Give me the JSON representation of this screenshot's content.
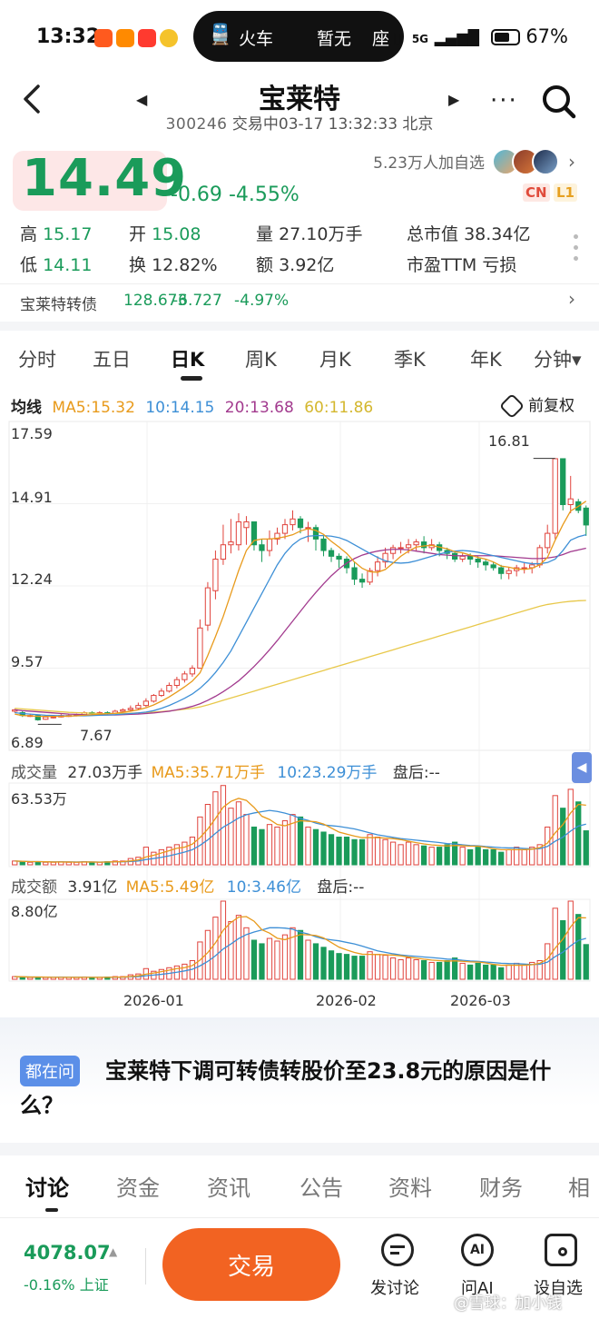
{
  "status_bar": {
    "time": "13:32",
    "island_icon": "train-icon",
    "island_label": "火车",
    "island_status": "暂无",
    "island_seat": "座",
    "network": "5G",
    "battery": "67%"
  },
  "header": {
    "stock_name": "宝莱特",
    "code": "300246",
    "trade_status": "交易中03-17 13:32:33 北京"
  },
  "quote": {
    "price": "14.49",
    "change": "-0.69",
    "change_pct": "-4.55%",
    "followers": "5.23万人加自选",
    "badge_cn": "CN",
    "badge_l1": "L1",
    "high_label": "高",
    "high": "15.17",
    "open_label": "开",
    "open": "15.08",
    "vol_label": "量",
    "vol": "27.10万手",
    "mcap_label": "总市值",
    "mcap": "38.34亿",
    "low_label": "低",
    "low": "14.11",
    "turn_label": "换",
    "turn": "12.82%",
    "amt_label": "额",
    "amt": "3.92亿",
    "pe_label": "市盈TTM",
    "pe": "亏损"
  },
  "bond": {
    "name": "宝莱特转债",
    "price": "128.673",
    "change": "-6.727",
    "change_pct": "-4.97%"
  },
  "kline_tabs": [
    "分时",
    "五日",
    "日K",
    "周K",
    "月K",
    "季K",
    "年K",
    "分钟▾"
  ],
  "ma_line": {
    "label": "均线",
    "ma5": "MA5:15.32",
    "ma10": "10:14.15",
    "ma20": "20:13.68",
    "ma60": "60:11.86",
    "adjust": "前复权"
  },
  "colors": {
    "up": "#e0433c",
    "down": "#1a9b5a",
    "ma5": "#e89a1b",
    "ma10": "#3d8fd6",
    "ma20": "#a23a8e",
    "ma60": "#e8c84a"
  },
  "price_axis": [
    "17.59",
    "14.91",
    "12.24",
    "9.57",
    "6.89"
  ],
  "high_marker": "16.81",
  "low_marker": "7.67",
  "volume": {
    "label": "成交量",
    "value": "27.03万手",
    "ma5": "MA5:35.71万手",
    "ma10": "10:23.29万手",
    "after": "盘后:--",
    "axis_max": "63.53万"
  },
  "amount": {
    "label": "成交额",
    "value": "3.91亿",
    "ma5": "MA5:5.49亿",
    "ma10": "10:3.46亿",
    "after": "盘后:--",
    "axis_max": "8.80亿"
  },
  "date_axis": [
    "2026-01",
    "2026-02",
    "2026-03"
  ],
  "chart_data": {
    "type": "candlestick",
    "ylim": [
      6.89,
      17.59
    ],
    "candles": [
      [
        8.0,
        8.05,
        7.95,
        8.08
      ],
      [
        7.95,
        7.85,
        7.8,
        8.0
      ],
      [
        7.85,
        7.85,
        7.8,
        7.92
      ],
      [
        7.85,
        7.7,
        7.67,
        7.88
      ],
      [
        7.72,
        7.8,
        7.7,
        7.84
      ],
      [
        7.8,
        7.8,
        7.75,
        7.86
      ],
      [
        7.8,
        7.85,
        7.78,
        7.9
      ],
      [
        7.85,
        7.85,
        7.8,
        7.9
      ],
      [
        7.85,
        7.88,
        7.82,
        7.92
      ],
      [
        7.88,
        7.95,
        7.85,
        8.0
      ],
      [
        7.95,
        7.92,
        7.88,
        8.0
      ],
      [
        7.92,
        7.95,
        7.88,
        8.0
      ],
      [
        7.95,
        7.92,
        7.88,
        8.0
      ],
      [
        7.92,
        8.0,
        7.9,
        8.05
      ],
      [
        8.0,
        8.05,
        7.95,
        8.1
      ],
      [
        8.05,
        8.1,
        8.0,
        8.2
      ],
      [
        8.1,
        8.2,
        8.05,
        8.3
      ],
      [
        8.2,
        8.35,
        8.15,
        8.45
      ],
      [
        8.35,
        8.55,
        8.3,
        8.6
      ],
      [
        8.55,
        8.7,
        8.5,
        8.8
      ],
      [
        8.7,
        8.9,
        8.65,
        9.0
      ],
      [
        8.9,
        9.1,
        8.8,
        9.2
      ],
      [
        9.1,
        9.3,
        9.0,
        9.4
      ],
      [
        9.3,
        9.5,
        9.2,
        9.6
      ],
      [
        9.5,
        10.9,
        9.5,
        11.2
      ],
      [
        11.0,
        12.3,
        10.8,
        12.5
      ],
      [
        12.2,
        13.3,
        11.9,
        13.6
      ],
      [
        13.3,
        13.8,
        13.1,
        14.5
      ],
      [
        13.8,
        13.9,
        13.5,
        14.7
      ],
      [
        13.8,
        14.6,
        13.6,
        14.9
      ],
      [
        14.4,
        14.6,
        13.8,
        14.8
      ],
      [
        14.6,
        13.8,
        13.6,
        14.6
      ],
      [
        13.8,
        13.6,
        13.2,
        14.0
      ],
      [
        13.6,
        14.0,
        13.4,
        14.3
      ],
      [
        14.0,
        14.2,
        13.8,
        14.4
      ],
      [
        14.2,
        14.5,
        14.0,
        14.7
      ],
      [
        14.5,
        14.7,
        14.3,
        15.0
      ],
      [
        14.7,
        14.4,
        14.2,
        14.8
      ],
      [
        14.4,
        14.4,
        13.9,
        14.6
      ],
      [
        14.4,
        14.0,
        13.6,
        14.5
      ],
      [
        14.0,
        13.6,
        13.4,
        14.1
      ],
      [
        13.6,
        13.4,
        13.2,
        13.7
      ],
      [
        13.4,
        13.3,
        13.0,
        13.5
      ],
      [
        13.3,
        13.0,
        12.8,
        13.4
      ],
      [
        13.0,
        12.6,
        12.4,
        13.2
      ],
      [
        12.6,
        12.5,
        12.3,
        12.8
      ],
      [
        12.5,
        12.9,
        12.4,
        13.0
      ],
      [
        12.9,
        13.2,
        12.7,
        13.4
      ],
      [
        13.2,
        13.5,
        13.0,
        13.7
      ],
      [
        13.5,
        13.7,
        13.3,
        13.8
      ],
      [
        13.7,
        13.7,
        13.5,
        13.9
      ],
      [
        13.7,
        13.8,
        13.5,
        14.0
      ],
      [
        13.8,
        13.9,
        13.6,
        14.0
      ],
      [
        13.9,
        13.7,
        13.5,
        14.1
      ],
      [
        13.7,
        13.8,
        13.6,
        14.0
      ],
      [
        13.8,
        13.6,
        13.4,
        13.9
      ],
      [
        13.6,
        13.5,
        13.3,
        13.7
      ],
      [
        13.5,
        13.3,
        13.2,
        13.6
      ],
      [
        13.3,
        13.4,
        13.2,
        13.5
      ],
      [
        13.4,
        13.3,
        13.1,
        13.5
      ],
      [
        13.3,
        13.2,
        13.0,
        13.4
      ],
      [
        13.2,
        13.1,
        12.9,
        13.3
      ],
      [
        13.1,
        13.0,
        12.9,
        13.2
      ],
      [
        13.0,
        12.8,
        12.6,
        13.1
      ],
      [
        12.8,
        12.9,
        12.6,
        13.0
      ],
      [
        12.9,
        13.0,
        12.7,
        13.1
      ],
      [
        13.0,
        13.0,
        12.8,
        13.2
      ],
      [
        13.0,
        13.1,
        12.8,
        13.2
      ],
      [
        13.1,
        13.7,
        13.0,
        13.8
      ],
      [
        13.7,
        14.2,
        13.5,
        14.5
      ],
      [
        14.2,
        16.8,
        14.0,
        16.81
      ],
      [
        16.8,
        15.2,
        15.0,
        16.7
      ],
      [
        15.2,
        15.4,
        14.9,
        16.2
      ],
      [
        15.3,
        15.0,
        14.9,
        15.4
      ],
      [
        15.08,
        14.49,
        14.11,
        15.17
      ]
    ],
    "ma5": [
      7.9,
      7.85,
      7.84,
      7.82,
      7.82,
      7.82,
      7.82,
      7.83,
      7.84,
      7.86,
      7.88,
      7.9,
      7.91,
      7.93,
      7.96,
      8.0,
      8.05,
      8.12,
      8.22,
      8.35,
      8.5,
      8.67,
      8.85,
      9.05,
      9.34,
      9.94,
      10.6,
      11.3,
      12.1,
      12.9,
      13.6,
      13.95,
      14.0,
      14.0,
      14.03,
      14.08,
      14.15,
      14.28,
      14.36,
      14.3,
      14.16,
      13.92,
      13.72,
      13.5,
      13.2,
      12.98,
      12.86,
      12.84,
      12.94,
      13.16,
      13.4,
      13.58,
      13.72,
      13.76,
      13.78,
      13.72,
      13.66,
      13.56,
      13.52,
      13.44,
      13.36,
      13.3,
      13.2,
      13.06,
      13.02,
      12.96,
      12.94,
      12.98,
      13.1,
      13.36,
      13.96,
      14.5,
      14.98,
      15.14,
      15.32
    ],
    "ma10": [
      7.95,
      7.92,
      7.9,
      7.88,
      7.86,
      7.85,
      7.84,
      7.84,
      7.84,
      7.84,
      7.85,
      7.86,
      7.87,
      7.88,
      7.9,
      7.92,
      7.94,
      7.97,
      8.02,
      8.1,
      8.2,
      8.32,
      8.45,
      8.6,
      8.8,
      9.05,
      9.35,
      9.7,
      10.1,
      10.6,
      11.1,
      11.6,
      12.1,
      12.6,
      13.1,
      13.5,
      13.8,
      14.0,
      14.1,
      14.12,
      14.12,
      14.1,
      14.05,
      13.95,
      13.8,
      13.65,
      13.5,
      13.36,
      13.24,
      13.18,
      13.16,
      13.18,
      13.24,
      13.32,
      13.4,
      13.48,
      13.54,
      13.58,
      13.6,
      13.58,
      13.54,
      13.48,
      13.42,
      13.36,
      13.3,
      13.24,
      13.18,
      13.14,
      13.14,
      13.18,
      13.3,
      13.6,
      13.96,
      14.08,
      14.15
    ],
    "ma20": [
      8.05,
      8.02,
      8.0,
      7.98,
      7.96,
      7.94,
      7.92,
      7.9,
      7.89,
      7.88,
      7.87,
      7.87,
      7.87,
      7.87,
      7.88,
      7.89,
      7.9,
      7.92,
      7.94,
      7.97,
      8.0,
      8.05,
      8.1,
      8.17,
      8.26,
      8.38,
      8.52,
      8.68,
      8.86,
      9.06,
      9.3,
      9.56,
      9.84,
      10.14,
      10.46,
      10.8,
      11.14,
      11.48,
      11.82,
      12.14,
      12.44,
      12.72,
      12.96,
      13.16,
      13.32,
      13.44,
      13.52,
      13.58,
      13.62,
      13.64,
      13.64,
      13.62,
      13.58,
      13.54,
      13.5,
      13.46,
      13.44,
      13.42,
      13.42,
      13.42,
      13.42,
      13.42,
      13.42,
      13.4,
      13.38,
      13.36,
      13.34,
      13.32,
      13.32,
      13.34,
      13.38,
      13.46,
      13.56,
      13.62,
      13.68
    ],
    "ma60": [
      8.1,
      8.08,
      8.06,
      8.04,
      8.02,
      8.0,
      7.98,
      7.96,
      7.95,
      7.94,
      7.93,
      7.92,
      7.92,
      7.92,
      7.92,
      7.93,
      7.94,
      7.95,
      7.97,
      7.99,
      8.01,
      8.04,
      8.07,
      8.1,
      8.15,
      8.22,
      8.3,
      8.38,
      8.46,
      8.54,
      8.62,
      8.7,
      8.78,
      8.86,
      8.94,
      9.02,
      9.1,
      9.18,
      9.26,
      9.34,
      9.42,
      9.5,
      9.58,
      9.66,
      9.74,
      9.82,
      9.9,
      9.98,
      10.06,
      10.14,
      10.22,
      10.3,
      10.38,
      10.46,
      10.54,
      10.62,
      10.7,
      10.78,
      10.86,
      10.94,
      11.02,
      11.1,
      11.18,
      11.26,
      11.34,
      11.42,
      11.5,
      11.58,
      11.66,
      11.72,
      11.76,
      11.8,
      11.83,
      11.85,
      11.86
    ],
    "volume_wan": [
      3,
      2.5,
      2,
      2.5,
      2,
      2,
      2.5,
      2,
      2,
      2.5,
      2,
      2,
      2.5,
      3,
      3,
      5,
      6,
      14,
      10,
      12,
      14,
      16,
      18,
      22,
      38,
      48,
      58,
      63,
      45,
      50,
      40,
      30,
      28,
      32,
      30,
      35,
      40,
      38,
      30,
      28,
      26,
      24,
      22,
      22,
      20,
      20,
      24,
      22,
      20,
      18,
      16,
      18,
      16,
      15,
      14,
      14,
      16,
      18,
      14,
      12,
      14,
      12,
      12,
      10,
      12,
      14,
      12,
      14,
      16,
      30,
      55,
      45,
      60,
      50,
      27.03
    ],
    "amount_yi": [
      0.3,
      0.25,
      0.2,
      0.25,
      0.2,
      0.2,
      0.25,
      0.2,
      0.2,
      0.25,
      0.2,
      0.2,
      0.25,
      0.3,
      0.3,
      0.5,
      0.6,
      1.2,
      0.9,
      1.1,
      1.3,
      1.5,
      1.7,
      2.1,
      4.2,
      5.5,
      7.0,
      8.8,
      6.5,
      7.2,
      5.8,
      4.4,
      4.0,
      4.6,
      4.3,
      5.0,
      5.8,
      5.5,
      4.4,
      4.0,
      3.6,
      3.2,
      2.9,
      2.8,
      2.6,
      2.6,
      3.1,
      2.8,
      2.7,
      2.4,
      2.2,
      2.4,
      2.2,
      2.1,
      1.9,
      1.9,
      2.1,
      2.4,
      1.8,
      1.6,
      1.8,
      1.6,
      1.6,
      1.3,
      1.6,
      1.8,
      1.6,
      1.9,
      2.1,
      4.0,
      8.0,
      6.6,
      8.8,
      7.3,
      3.91
    ]
  },
  "question": {
    "tag": "都在问",
    "text": "宝莱特下调可转债转股价至23.8元的原因是什么？"
  },
  "bottom_tabs": [
    "讨论",
    "资金",
    "资讯",
    "公告",
    "资料",
    "财务",
    "相"
  ],
  "bottom_bar": {
    "index_value": "4078.07",
    "index_change": "-0.16% 上证",
    "trade_label": "交易",
    "actions": [
      "发讨论",
      "问AI",
      "设自选"
    ]
  },
  "watermark": "@雪球：加小钱"
}
